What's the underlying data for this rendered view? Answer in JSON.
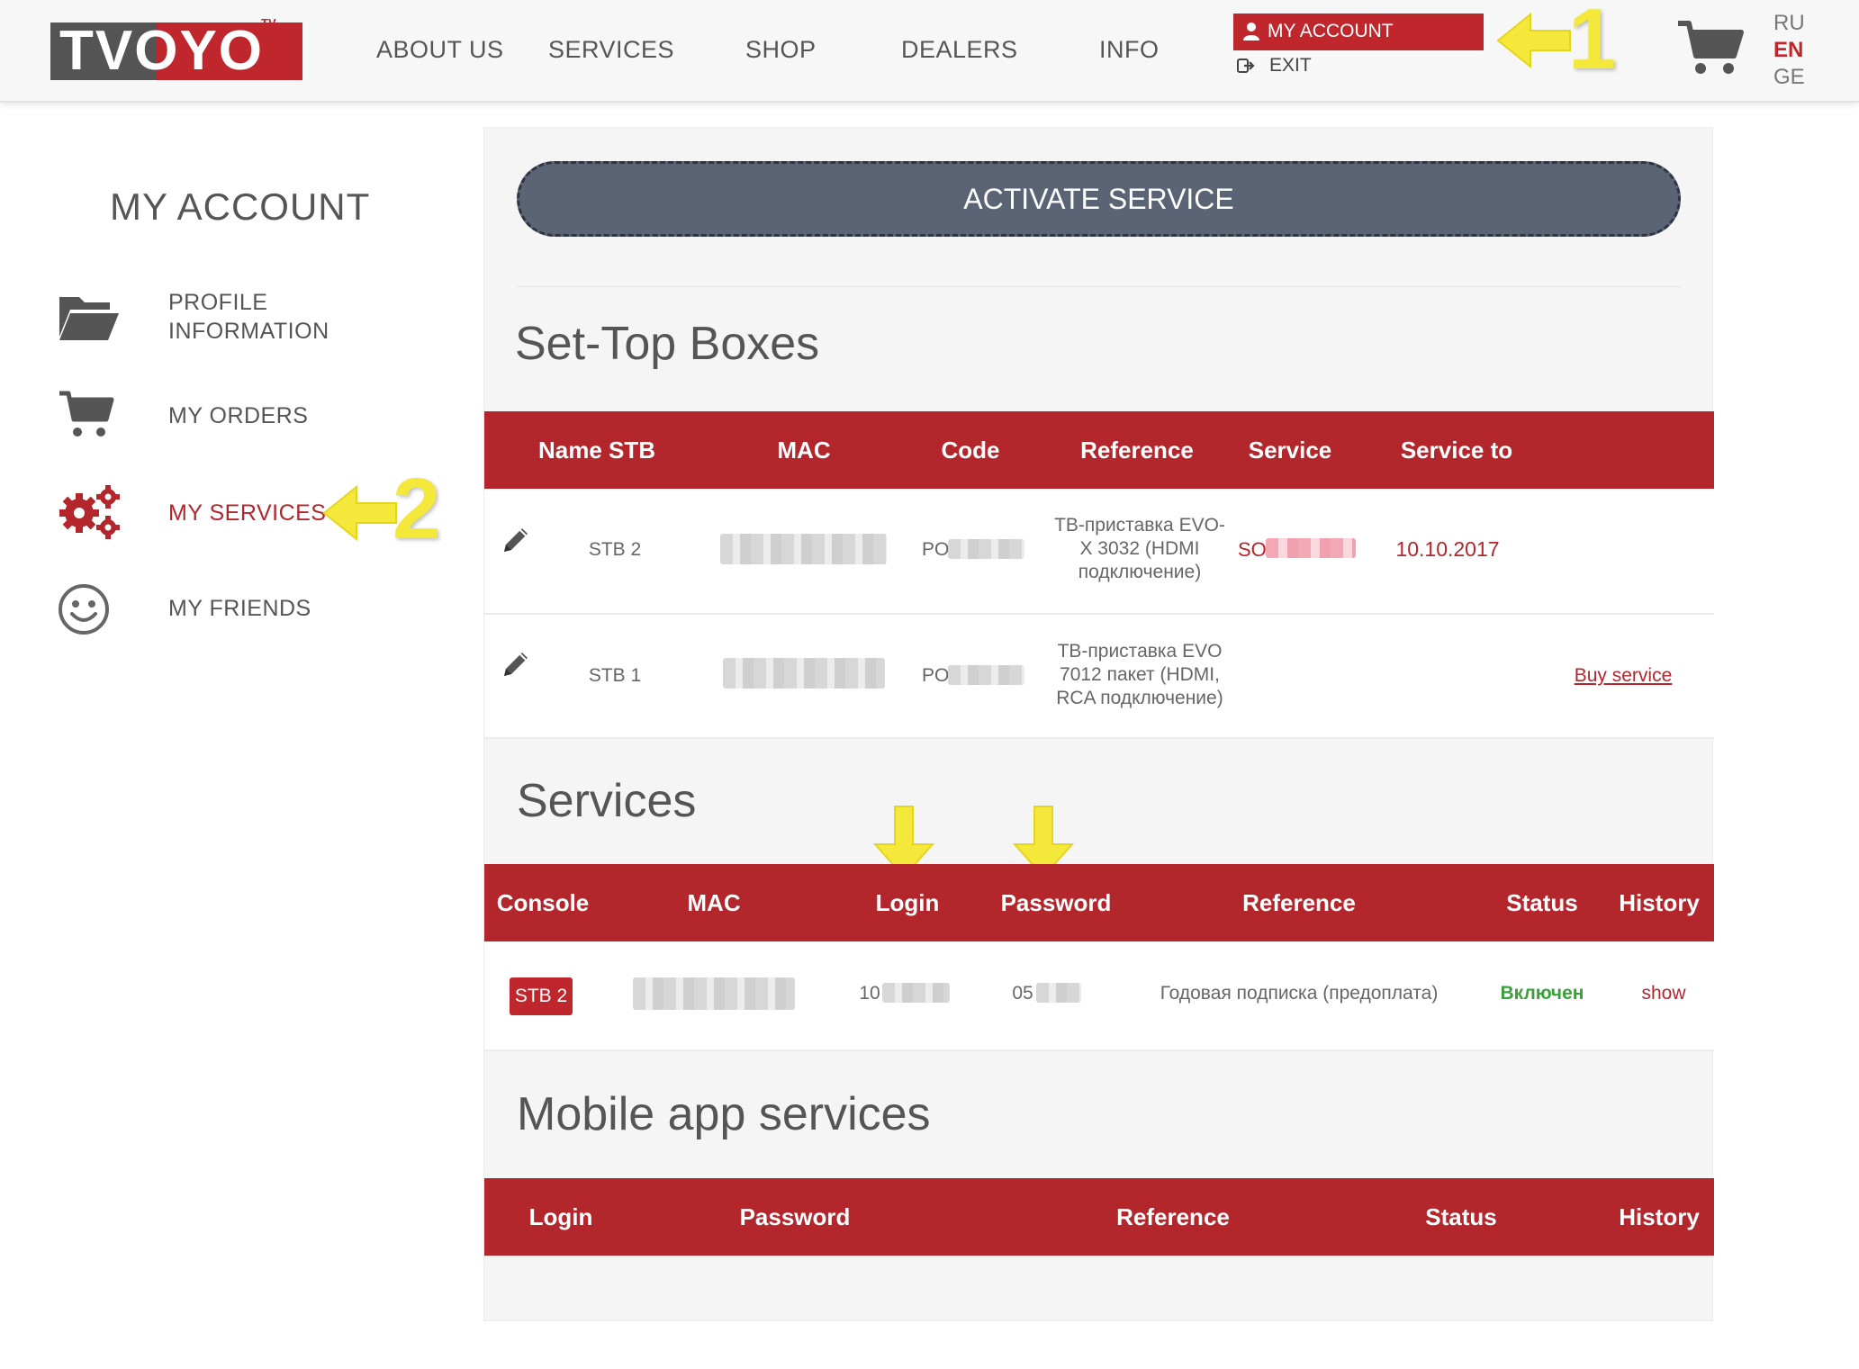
{
  "header": {
    "logo_text": "TVOYO",
    "logo_tv": "TV",
    "nav": [
      "ABOUT US",
      "SERVICES",
      "SHOP",
      "DEALERS",
      "INFO"
    ],
    "my_account": "MY ACCOUNT",
    "exit": "EXIT",
    "annotation_1": "1",
    "languages": [
      "RU",
      "EN",
      "GE"
    ],
    "active_language": "EN"
  },
  "sidebar": {
    "title": "MY ACCOUNT",
    "items": [
      {
        "label": "PROFILE\nINFORMATION",
        "icon": "folder-icon"
      },
      {
        "label": "MY ORDERS",
        "icon": "cart-icon"
      },
      {
        "label": "MY SERVICES",
        "icon": "gears-icon",
        "active": true
      },
      {
        "label": "MY FRIENDS",
        "icon": "smiley-icon"
      }
    ],
    "annotation_2": "2"
  },
  "main": {
    "activate_button": "ACTIVATE SERVICE",
    "stb": {
      "title": "Set-Top Boxes",
      "columns": [
        "Name STB",
        "MAC",
        "Code",
        "Reference",
        "Service",
        "Service to"
      ],
      "rows": [
        {
          "name": "STB 2",
          "code_prefix": "PO",
          "reference": "ТВ-приставка EVO-X 3032 (HDMI подключение)",
          "service_prefix": "SO",
          "service_to": "10.10.2017",
          "action": ""
        },
        {
          "name": "STB 1",
          "code_prefix": "PO",
          "reference": "ТВ-приставка EVO 7012 пакет (HDMI, RCA подключение)",
          "service_prefix": "",
          "service_to": "",
          "action": "Buy service"
        }
      ]
    },
    "services": {
      "title": "Services",
      "columns": [
        "Console",
        "MAC",
        "Login",
        "Password",
        "Reference",
        "Status",
        "History"
      ],
      "rows": [
        {
          "console": "STB 2",
          "login_prefix": "10",
          "password_prefix": "05",
          "reference": "Годовая подписка (предоплата)",
          "status": "Включен",
          "history": "show"
        }
      ]
    },
    "mobile": {
      "title": "Mobile app services",
      "columns": [
        "Login",
        "Password",
        "Reference",
        "Status",
        "History"
      ]
    }
  },
  "colors": {
    "brand_red": "#b3262c",
    "status_green": "#3aa13a",
    "annotation_yellow": "#f4e83a",
    "activate_bg": "#5b6474"
  }
}
